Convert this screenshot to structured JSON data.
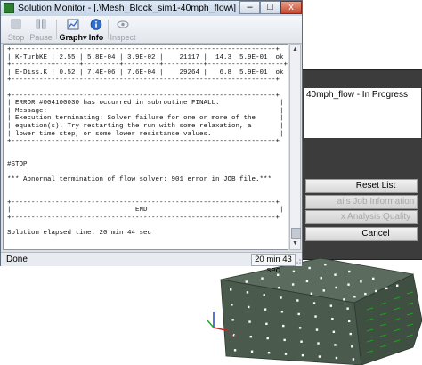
{
  "window": {
    "title": "Solution Monitor - [.\\Mesh_Block_sim1-40mph_flow\\]",
    "controls": {
      "minimize": "–",
      "maximize": "□",
      "close": "x"
    }
  },
  "toolbar": {
    "stop": {
      "label": "Stop",
      "icon": "stop-icon",
      "enabled": false
    },
    "pause": {
      "label": "Pause",
      "icon": "pause-icon",
      "enabled": false
    },
    "graph": {
      "label": "Graph",
      "icon": "graph-icon",
      "enabled": true,
      "has_menu": true
    },
    "info": {
      "label": "Info",
      "icon": "info-icon",
      "enabled": true
    },
    "inspect": {
      "label": "Inspect",
      "icon": "eye-icon",
      "enabled": false
    }
  },
  "console_lines": [
    "+------------------------------------------------------------------+",
    "| K-TurbKE | 2.55 | 5.8E-04 | 3.9E-02 |    21117 |  14.3  5.9E-01  ok |",
    "+----------+------+---------+---------+----------+-------------------+",
    "| E-Diss.K | 0.52 | 7.4E-06 | 7.6E-04 |    29264 |   6.8  5.9E-01  ok |",
    "+------------------------------------------------------------------+",
    "",
    "+------------------------------------------------------------------+",
    "| ERROR #004100030 has occurred in subroutine FINALL.               |",
    "| Message:                                                          |",
    "| Execution terminating: Solver failure for one or more of the      |",
    "| equation(s). Try restarting the run with some relaxation, a       |",
    "| lower time step, or some lower resistance values.                 |",
    "+------------------------------------------------------------------+",
    "",
    "",
    "#STOP",
    "",
    "*** Abnormal termination of flow solver: 901 error in JOB file.***",
    "",
    "",
    "+------------------------------------------------------------------+",
    "|                               END                                 |",
    "+------------------------------------------------------------------+",
    "",
    "Solution elapsed time: 20 min 44 sec"
  ],
  "status": {
    "text": "Done",
    "elapsed": "20 min 43 sec"
  },
  "background_window": {
    "status_line": "40mph_flow - In Progress",
    "buttons": [
      {
        "label": "Reset List",
        "enabled": true
      },
      {
        "label": "ails Job Information",
        "enabled": false
      },
      {
        "label": "x Analysis Quality",
        "enabled": false
      },
      {
        "label": "Cancel",
        "enabled": true
      }
    ]
  },
  "axis_labels": {
    "x": "XC"
  },
  "colors": {
    "mesh_block": "#4a5a4d",
    "mesh_markers": "#ffffff",
    "boundary_arrows": "#1fa01f",
    "close_button": "#c8452c"
  }
}
